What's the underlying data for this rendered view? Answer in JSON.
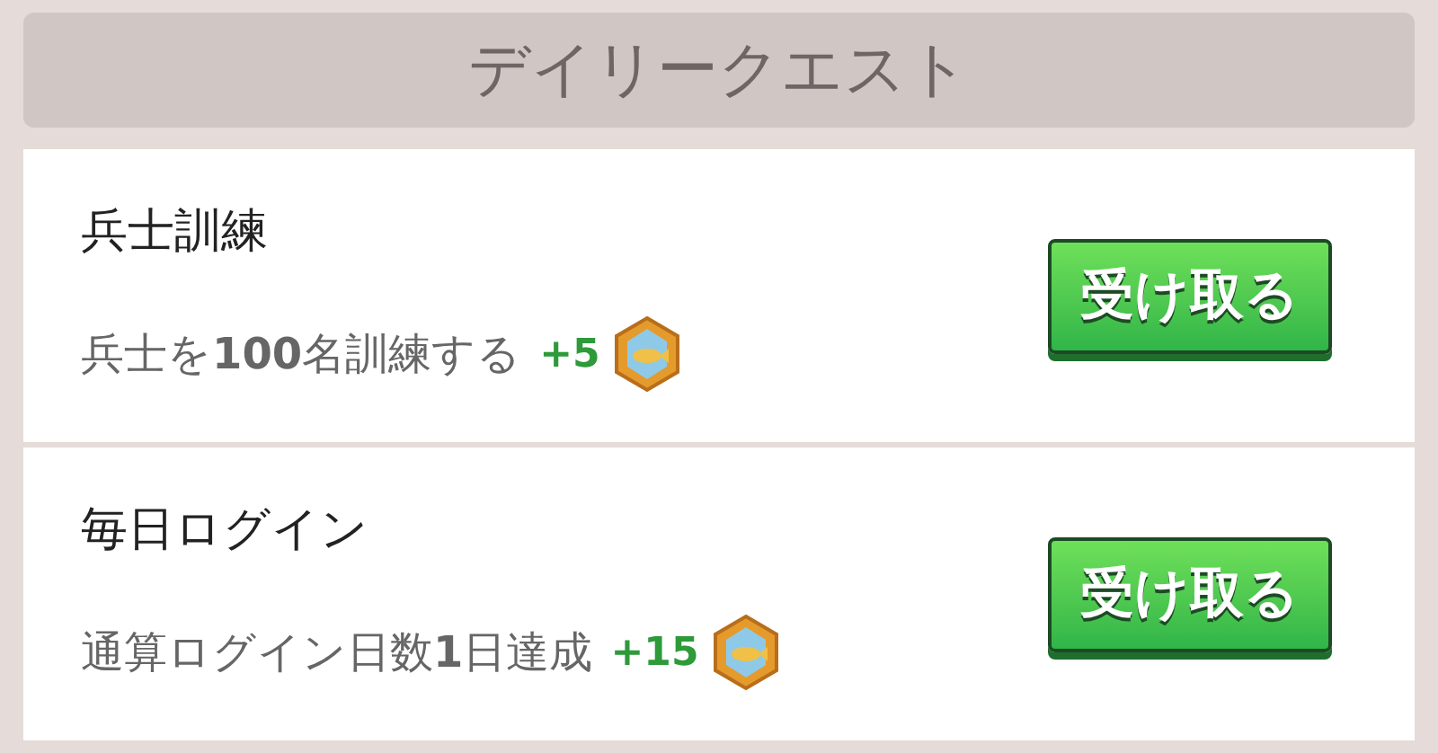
{
  "header": {
    "title": "デイリークエスト"
  },
  "quests": [
    {
      "title": "兵士訓練",
      "description": "兵士を**100**名訓練する",
      "reward": "+5",
      "button": "受け取る"
    },
    {
      "title": "毎日ログイン",
      "description": "通算ログイン日数**1**日達成",
      "reward": "+15",
      "button": "受け取る"
    }
  ]
}
